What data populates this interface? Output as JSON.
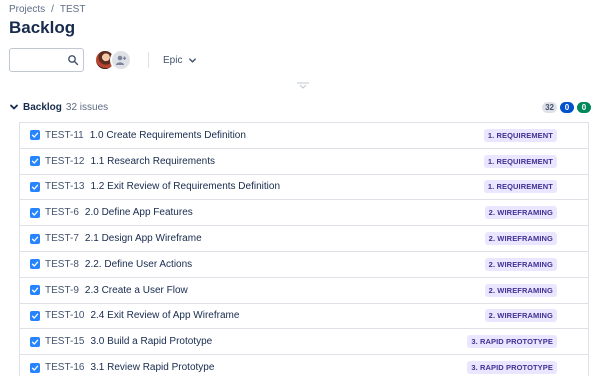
{
  "breadcrumb": {
    "projects": "Projects",
    "separator": "/",
    "project": "TEST"
  },
  "page_title": "Backlog",
  "toolbar": {
    "search_value": "",
    "search_icon": "search-icon",
    "epic_label": "Epic"
  },
  "backlog": {
    "title": "Backlog",
    "count_label": "32 issues",
    "badges": {
      "todo": "32",
      "in_progress": "0",
      "done": "0"
    }
  },
  "colors": {
    "accent": "#0052cc",
    "checkbox": "#2684ff",
    "epic_bg": "#eae6ff",
    "epic_text": "#403294",
    "done_badge": "#00875a"
  },
  "issues": [
    {
      "key": "TEST-11",
      "summary": "1.0 Create Requirements Definition",
      "epic": "1. REQUIREMENT"
    },
    {
      "key": "TEST-12",
      "summary": "1.1 Research Requirements",
      "epic": "1. REQUIREMENT"
    },
    {
      "key": "TEST-13",
      "summary": "1.2 Exit Review of Requirements Definition",
      "epic": "1. REQUIREMENT"
    },
    {
      "key": "TEST-6",
      "summary": "2.0 Define App Features",
      "epic": "2. WIREFRAMING"
    },
    {
      "key": "TEST-7",
      "summary": "2.1 Design App Wireframe",
      "epic": "2. WIREFRAMING"
    },
    {
      "key": "TEST-8",
      "summary": "2.2. Define User Actions",
      "epic": "2. WIREFRAMING"
    },
    {
      "key": "TEST-9",
      "summary": "2.3 Create a User Flow",
      "epic": "2. WIREFRAMING"
    },
    {
      "key": "TEST-10",
      "summary": "2.4 Exit Review of App Wireframe",
      "epic": "2. WIREFRAMING"
    },
    {
      "key": "TEST-15",
      "summary": "3.0 Build a Rapid Prototype",
      "epic": "3. RAPID PROTOTYPE"
    },
    {
      "key": "TEST-16",
      "summary": "3.1 Review Rapid Prototype",
      "epic": "3. RAPID PROTOTYPE"
    }
  ]
}
